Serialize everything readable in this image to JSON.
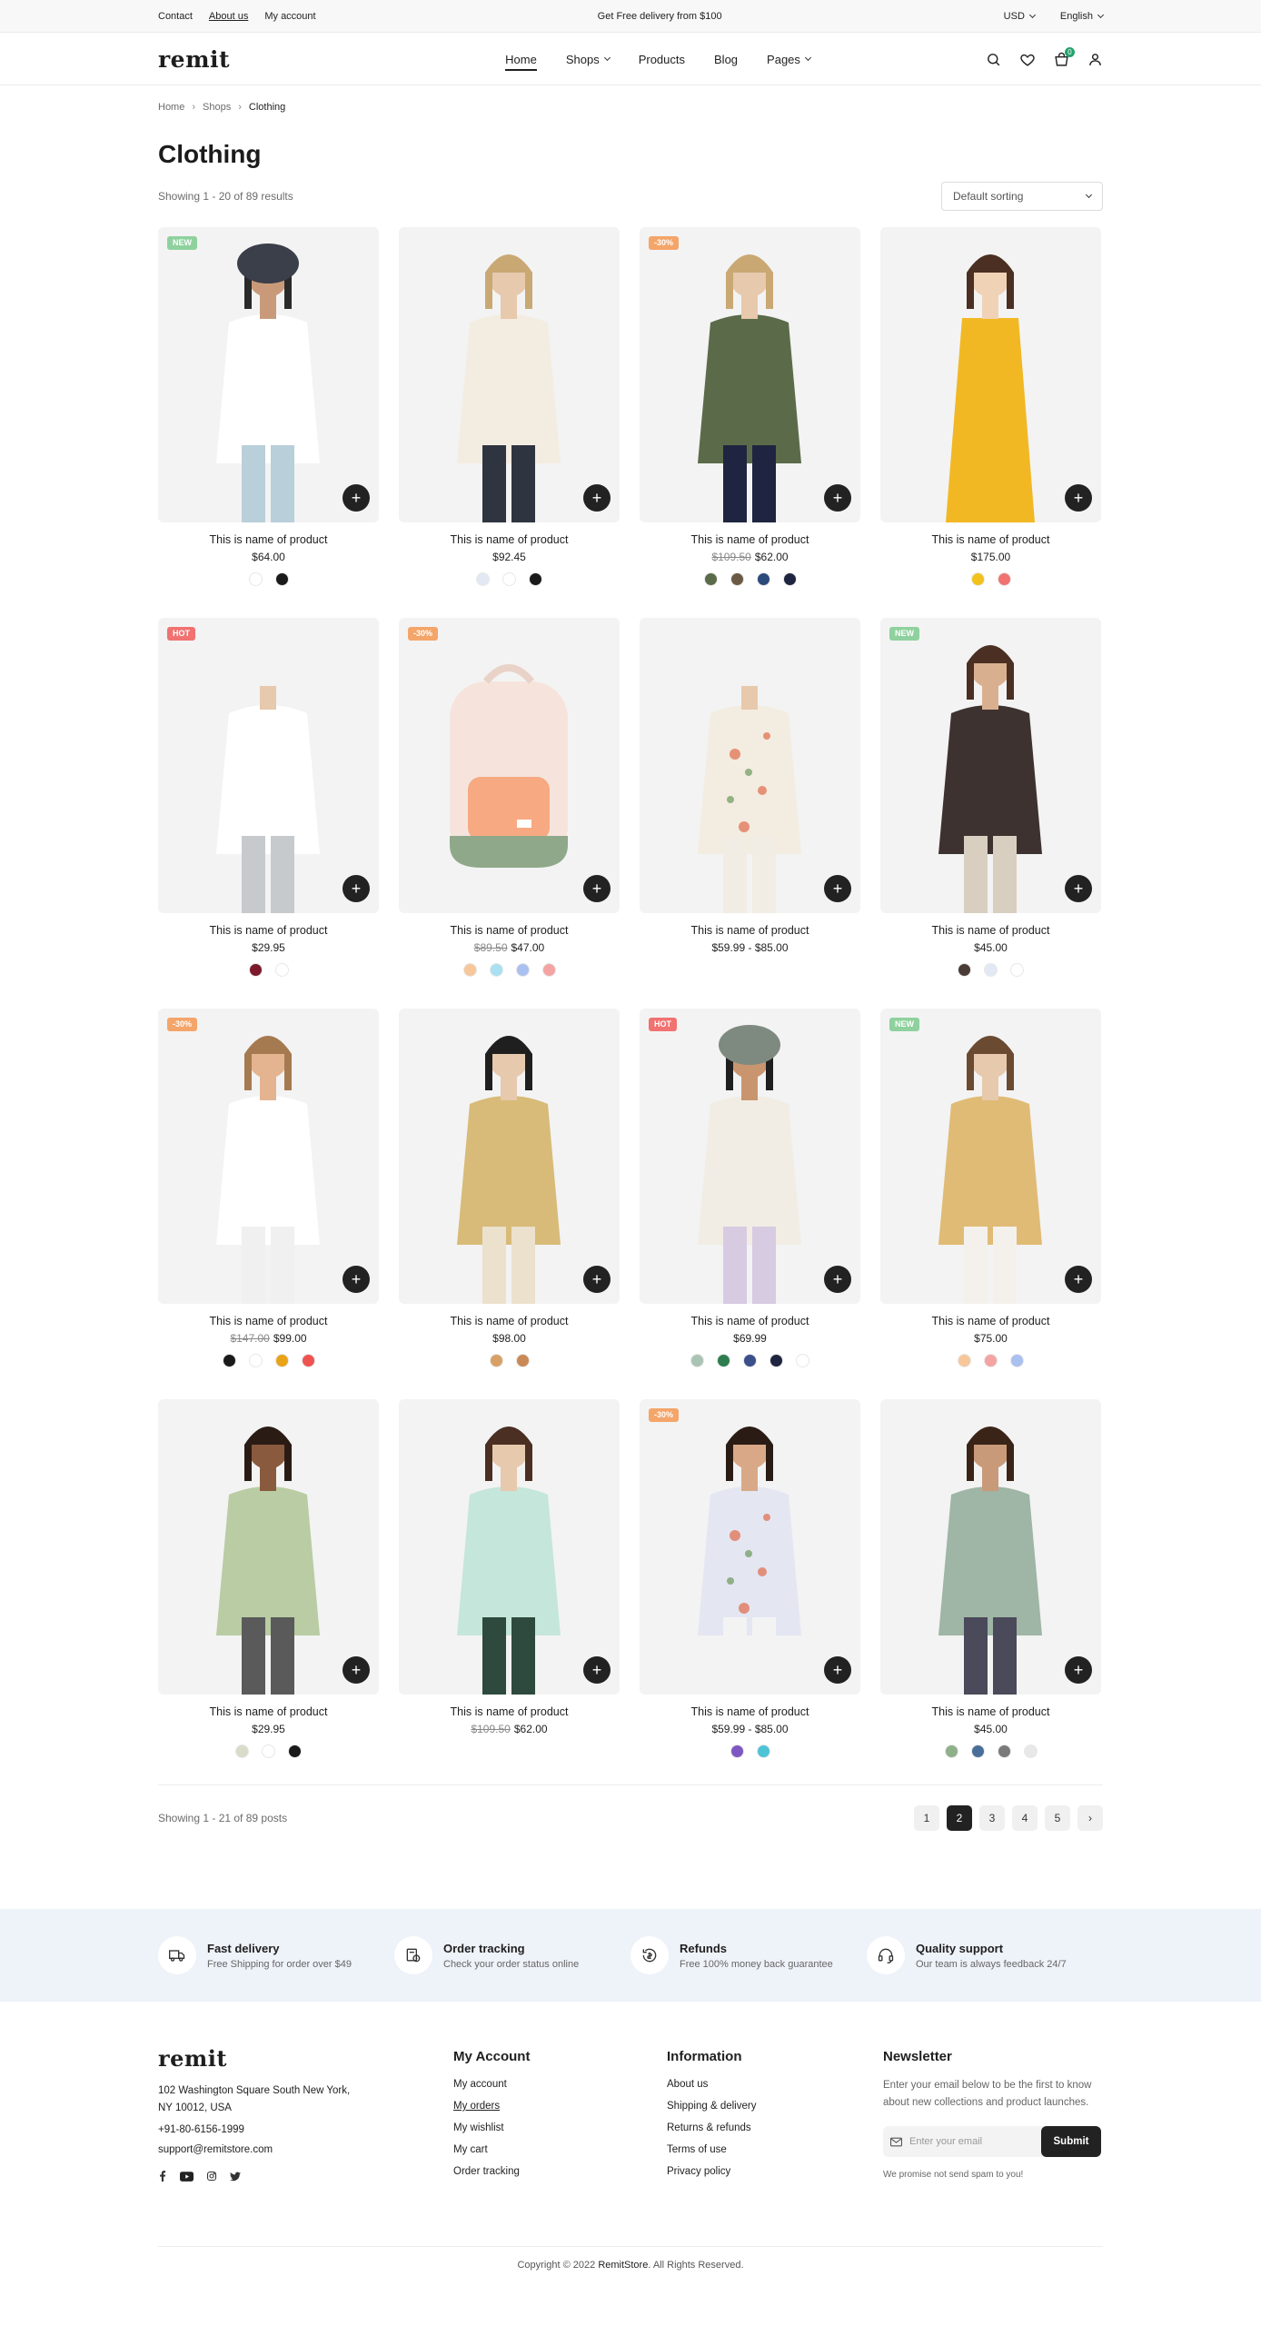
{
  "topbar": {
    "links": [
      "Contact",
      "About us",
      "My account"
    ],
    "promo": "Get Free delivery from $100",
    "currency": "USD",
    "language": "English"
  },
  "header": {
    "logo": "remit",
    "nav": [
      "Home",
      "Shops",
      "Products",
      "Blog",
      "Pages"
    ],
    "cart_count": "0"
  },
  "breadcrumb": [
    "Home",
    "Shops",
    "Clothing"
  ],
  "page": {
    "title": "Clothing",
    "results": "Showing 1 - 20 of 89 results",
    "sort": "Default sorting"
  },
  "products": [
    {
      "name": "This is name of product",
      "price": "$64.00",
      "old": "",
      "tag": "NEW",
      "swatches": [
        "#ffffff",
        "#1a1a1a"
      ]
    },
    {
      "name": "This is name of product",
      "price": "$92.45",
      "old": "",
      "tag": "",
      "swatches": [
        "#e3e9f4",
        "#ffffff",
        "#1a1a1a"
      ]
    },
    {
      "name": "This is name of product",
      "price": "$62.00",
      "old": "$109.50",
      "tag": "-30%",
      "swatches": [
        "#5b6b4a",
        "#6a5a45",
        "#2c4a7a",
        "#1f2540"
      ]
    },
    {
      "name": "This is name of product",
      "price": "$175.00",
      "old": "",
      "tag": "",
      "swatches": [
        "#f2c21a",
        "#f07271"
      ]
    },
    {
      "name": "This is name of product",
      "price": "$29.95",
      "old": "",
      "tag": "HOT",
      "swatches": [
        "#7a1a2a",
        "#ffffff"
      ]
    },
    {
      "name": "This is name of product",
      "price": "$47.00",
      "old": "$89.50",
      "tag": "-30%",
      "swatches": [
        "#f7c79a",
        "#a9e0f2",
        "#a9c0f0",
        "#f4a3a3"
      ]
    },
    {
      "name": "This is name of product",
      "price": "$59.99 - $85.00",
      "old": "",
      "tag": "",
      "swatches": []
    },
    {
      "name": "This is name of product",
      "price": "$45.00",
      "old": "",
      "tag": "NEW",
      "swatches": [
        "#4a3b36",
        "#e3e9f4",
        "#ffffff"
      ]
    },
    {
      "name": "This is name of product",
      "price": "$99.00",
      "old": "$147.00",
      "tag": "-30%",
      "swatches": [
        "#1a1a1a",
        "#ffffff",
        "#e8a317",
        "#ef5350"
      ]
    },
    {
      "name": "This is name of product",
      "price": "$98.00",
      "old": "",
      "tag": "",
      "swatches": [
        "#d9a066",
        "#c98a55"
      ]
    },
    {
      "name": "This is name of product",
      "price": "$69.99",
      "old": "",
      "tag": "HOT",
      "swatches": [
        "#a9c4b4",
        "#2e7d4f",
        "#3b4f8a",
        "#1f2540",
        "#ffffff"
      ]
    },
    {
      "name": "This is name of product",
      "price": "$75.00",
      "old": "",
      "tag": "NEW",
      "swatches": [
        "#f7c79a",
        "#f4a3a3",
        "#a9c0f0"
      ]
    },
    {
      "name": "This is name of product",
      "price": "$29.95",
      "old": "",
      "tag": "",
      "swatches": [
        "#d8dcc8",
        "#ffffff",
        "#1a1a1a"
      ]
    },
    {
      "name": "This is name of product",
      "price": "$62.00",
      "old": "$109.50",
      "tag": "",
      "swatches": []
    },
    {
      "name": "This is name of product",
      "price": "$59.99 - $85.00",
      "old": "",
      "tag": "-30%",
      "swatches": [
        "#7e57c2",
        "#4dc3d6"
      ]
    },
    {
      "name": "This is name of product",
      "price": "$45.00",
      "old": "",
      "tag": "",
      "swatches": [
        "#8fb08a",
        "#4a6e9a",
        "#7a7a7a",
        "#e8e8e8"
      ]
    }
  ],
  "pagination": {
    "summary": "Showing 1 - 21 of 89 posts",
    "pages": [
      "1",
      "2",
      "3",
      "4",
      "5"
    ],
    "active": "2"
  },
  "features": [
    {
      "icon": "truck-icon",
      "title": "Fast delivery",
      "sub": "Free Shipping for order over $49"
    },
    {
      "icon": "order-tracking-icon",
      "title": "Order tracking",
      "sub": "Check your order status online"
    },
    {
      "icon": "refund-icon",
      "title": "Refunds",
      "sub": "Free 100% money back guarantee"
    },
    {
      "icon": "headset-icon",
      "title": "Quality support",
      "sub": "Our team is always feedback 24/7"
    }
  ],
  "footer": {
    "logo": "remit",
    "address": "102 Washington Square South New York, NY 10012, USA",
    "phone": "+91-80-6156-1999",
    "email": "support@remitstore.com",
    "account_title": "My Account",
    "account_links": [
      "My account",
      "My orders",
      "My wishlist",
      "My cart",
      "Order tracking"
    ],
    "info_title": "Information",
    "info_links": [
      "About us",
      "Shipping & delivery",
      "Returns & refunds",
      "Terms of use",
      "Privacy policy"
    ],
    "news_title": "Newsletter",
    "news_desc": "Enter your email below to be the first to know about new collections and product launches.",
    "email_placeholder": "Enter your email",
    "submit": "Submit",
    "note": "We promise not send spam to you!",
    "copyright_pre": "Copyright © 2022 ",
    "copyright_brand": "RemitStore",
    "copyright_post": ". All Rights Reserved."
  },
  "colors": {
    "accent": "#23a26b",
    "dark": "#222222",
    "feature_bg": "#eef2f9"
  }
}
